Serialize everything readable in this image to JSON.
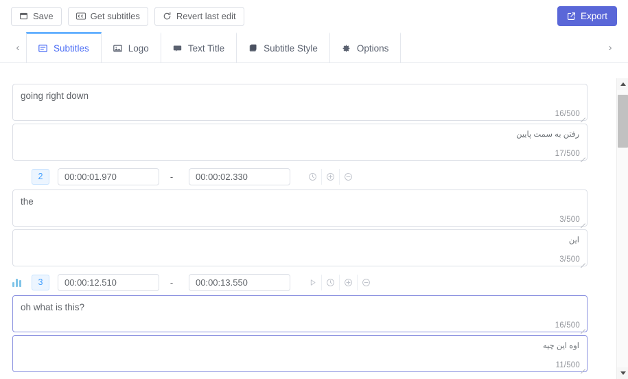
{
  "toolbar": {
    "buttons": [
      {
        "label": "Save",
        "icon": "save-icon"
      },
      {
        "label": "Get subtitles",
        "icon": "closed-caption-icon"
      },
      {
        "label": "Revert last edit",
        "icon": "refresh-icon"
      }
    ],
    "export": {
      "label": "Export",
      "icon": "external-link-icon",
      "color": "#5a67d8"
    }
  },
  "tabs": {
    "prev_icon": "chevron-left-icon",
    "next_icon": "chevron-right-icon",
    "items": [
      {
        "label": "Subtitles",
        "icon": "subtitles-icon",
        "active": true
      },
      {
        "label": "Logo",
        "icon": "image-icon",
        "active": false
      },
      {
        "label": "Text Title",
        "icon": "text-box-icon",
        "active": false
      },
      {
        "label": "Subtitle Style",
        "icon": "layers-icon",
        "active": false
      },
      {
        "label": "Options",
        "icon": "gear-icon",
        "active": false
      }
    ],
    "active_color": "#4c6ef5",
    "active_border_color": "#409eff"
  },
  "subtitles": [
    {
      "index": "",
      "show_header": false,
      "source_text": "going right down",
      "source_count": "16/500",
      "translation_text": "رفتن به سمت پایین",
      "translation_count": "17/500",
      "focused": false
    },
    {
      "index": "2",
      "show_header": true,
      "has_waveform": false,
      "start_time": "00:00:01.970",
      "end_time": "00:00:02.330",
      "separator": "-",
      "actions": [
        "sync-icon",
        "plus-circle-icon",
        "minus-circle-icon"
      ],
      "source_text": "the",
      "source_count": "3/500",
      "translation_text": "این",
      "translation_count": "3/500",
      "focused": false
    },
    {
      "index": "3",
      "show_header": true,
      "has_waveform": true,
      "waveform_icon": "audio-waveform-icon",
      "start_time": "00:00:12.510",
      "end_time": "00:00:13.550",
      "separator": "-",
      "actions": [
        "play-icon",
        "sync-icon",
        "plus-circle-icon",
        "minus-circle-icon"
      ],
      "source_text": "oh what is this?",
      "source_count": "16/500",
      "translation_text": "اوه این چیه",
      "translation_count": "11/500",
      "focused": true
    }
  ],
  "scrollbar": {
    "up_icon": "scroll-up-arrow-icon",
    "down_icon": "scroll-down-arrow-icon"
  }
}
